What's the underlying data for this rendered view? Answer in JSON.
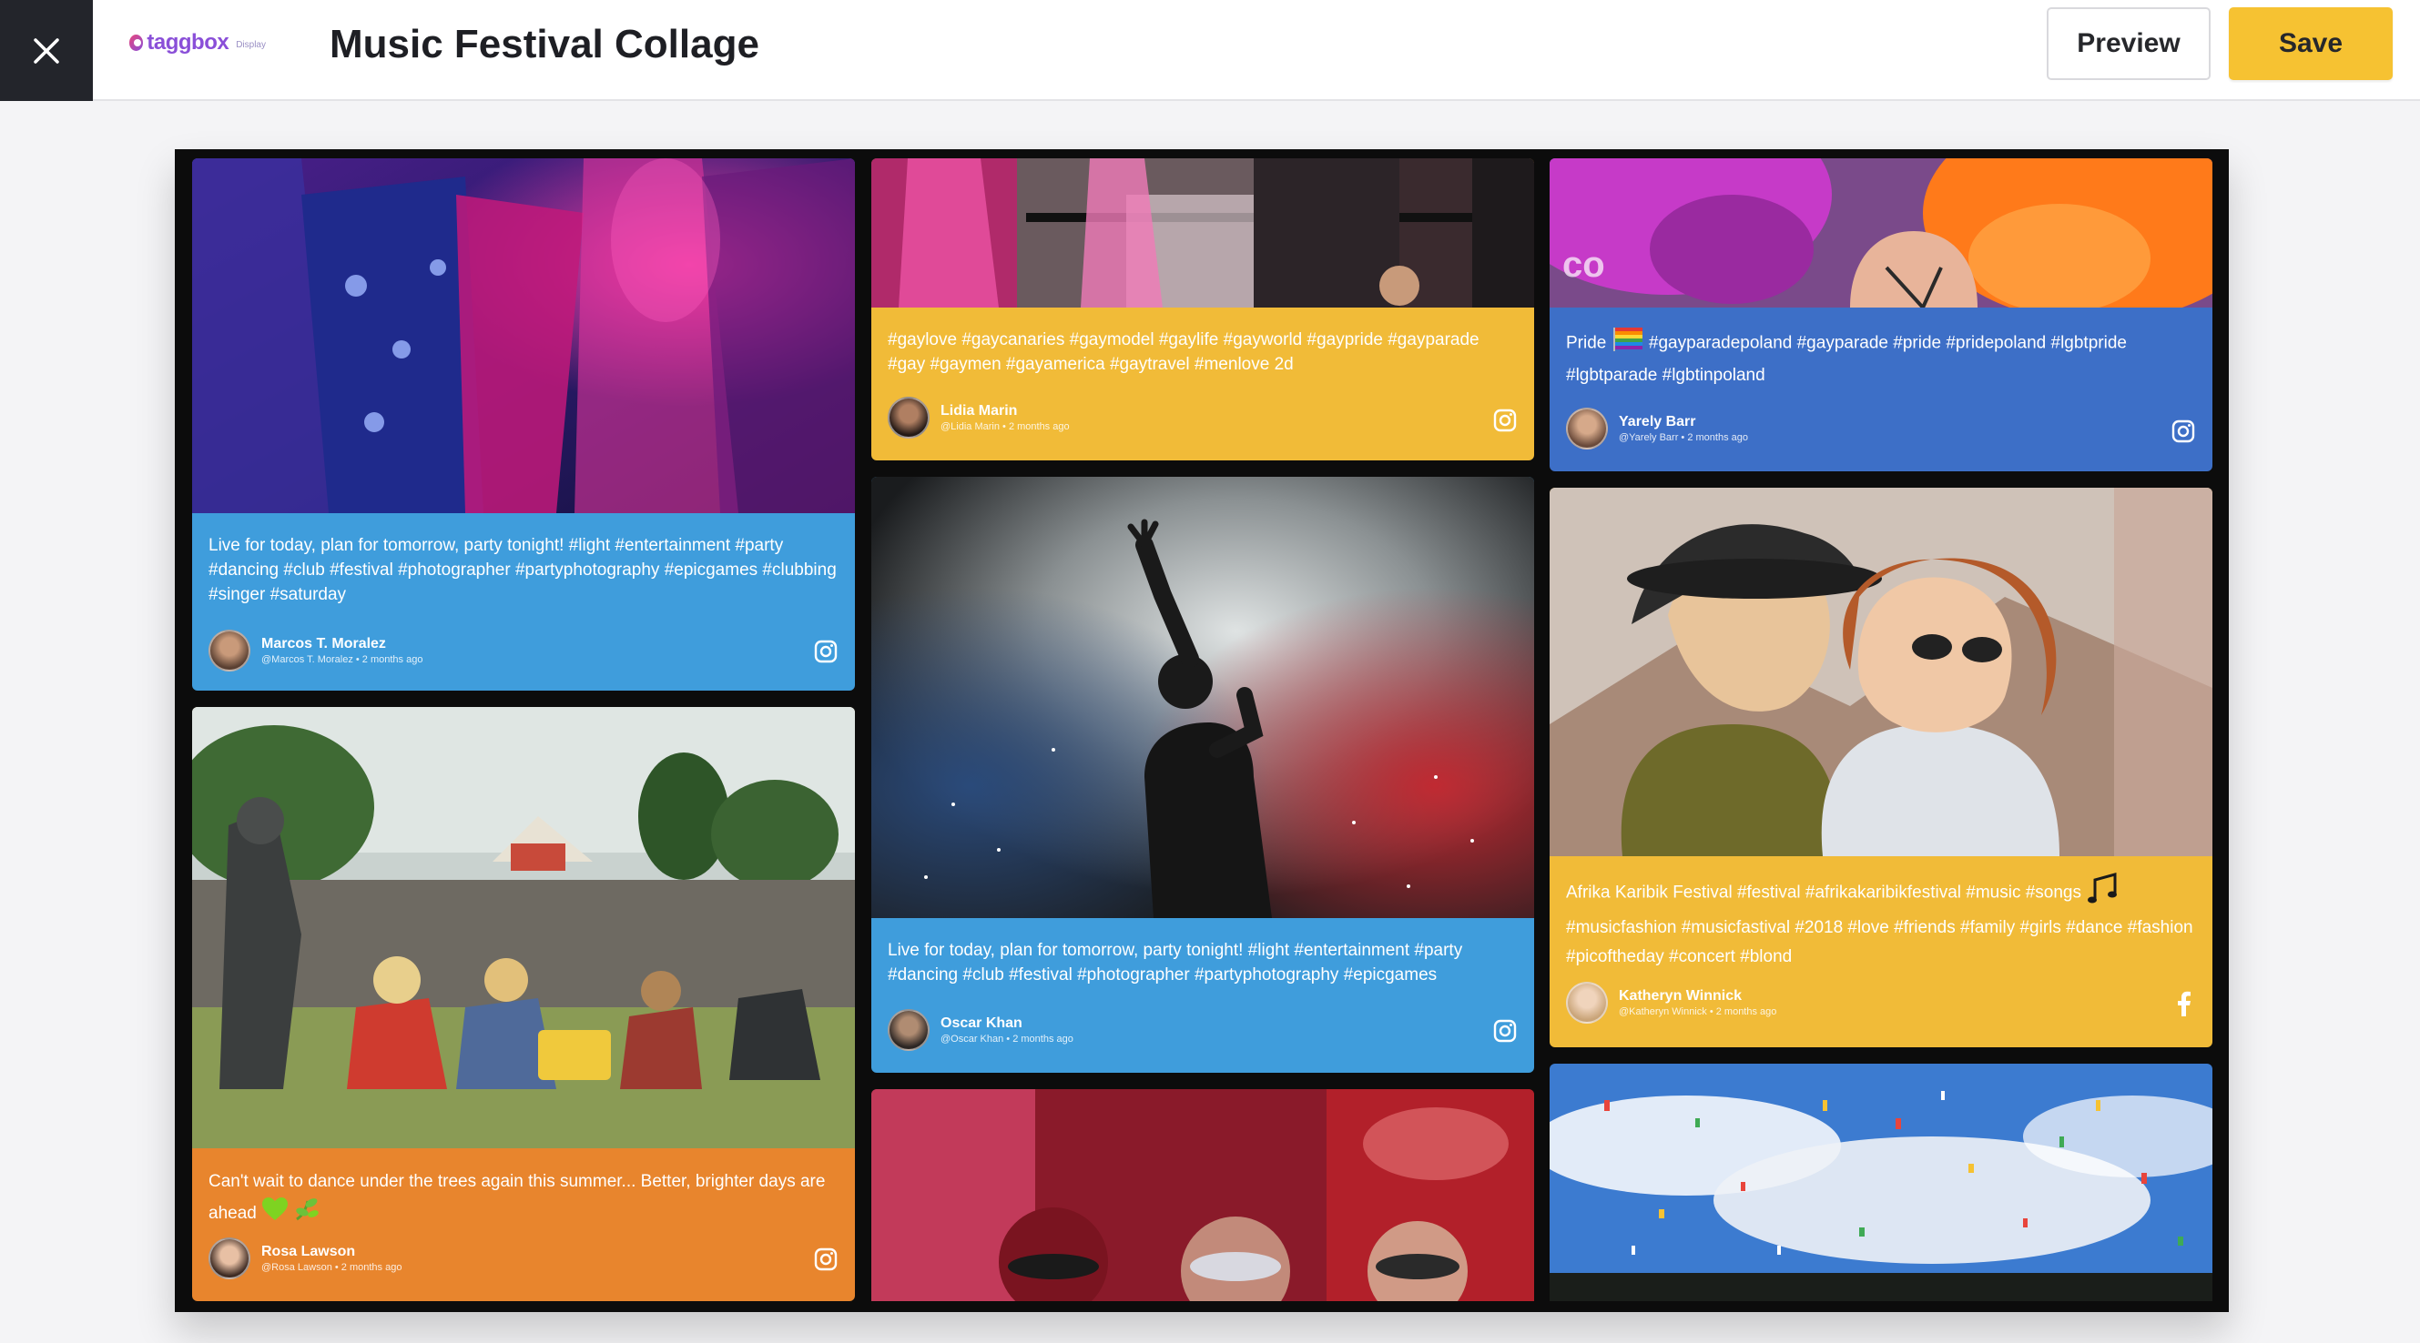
{
  "header": {
    "close_icon": "close-icon",
    "logo_text": "taggbox",
    "logo_sub": "Display",
    "title": "Music Festival Collage",
    "preview_label": "Preview",
    "save_label": "Save"
  },
  "colors": {
    "topbar_dark": "#23252b",
    "save_button": "#f6c232",
    "card_blue": "#3f9ddc",
    "card_yellow": "#f1bb38",
    "card_royal": "#3d6fc7",
    "card_orange": "#e8852d"
  },
  "posts": [
    {
      "text": "Live for today, plan for tomorrow, party tonight! #light #entertainment #party #dancing #club #festival #photographer #partyphotography #epicgames #clubbing #singer #saturday",
      "author": "Marcos T. Moralez",
      "handle": "@Marcos T. Moralez",
      "time": "2 months ago",
      "network": "instagram-icon"
    },
    {
      "text": "Can't wait to dance under the trees again this summer... Better, brighter days are ahead",
      "author": "Rosa Lawson",
      "handle": "@Rosa Lawson",
      "time": "2 months ago",
      "network": "instagram-icon"
    },
    {
      "text": "#gaylove #gaycanaries #gaymodel #gaylife #gayworld #gaypride #gayparade #gay #gaymen #gayamerica #gaytravel #menlove 2d",
      "author": "Lidia Marin",
      "handle": "@Lidia Marin",
      "time": "2 months ago",
      "network": "instagram-icon"
    },
    {
      "text": "Live for today, plan for tomorrow, party tonight! #light #entertainment #party #dancing #club #festival #photographer #partyphotography #epicgames",
      "author": "Oscar Khan",
      "handle": "@Oscar Khan",
      "time": "2 months ago",
      "network": "instagram-icon"
    },
    {
      "text_a": "Pride",
      "text_b": "#gayparadepoland #gayparade #pride #pridepoland #lgbtpride #lgbtparade #lgbtinpoland",
      "author": "Yarely Barr",
      "handle": "@Yarely Barr",
      "time": "2 months ago",
      "network": "instagram-icon"
    },
    {
      "text_a": "Afrika Karibik Festival #festival #afrikakaribikfestival #music #songs",
      "text_b": "#musicfashion #musicfastival #2018 #love #friends #family #girls #dance #fashion #picoftheday #concert #blond",
      "author": "Katheryn Winnick",
      "handle": "@Katheryn Winnick",
      "time": "2 months ago",
      "network": "facebook-icon"
    }
  ]
}
